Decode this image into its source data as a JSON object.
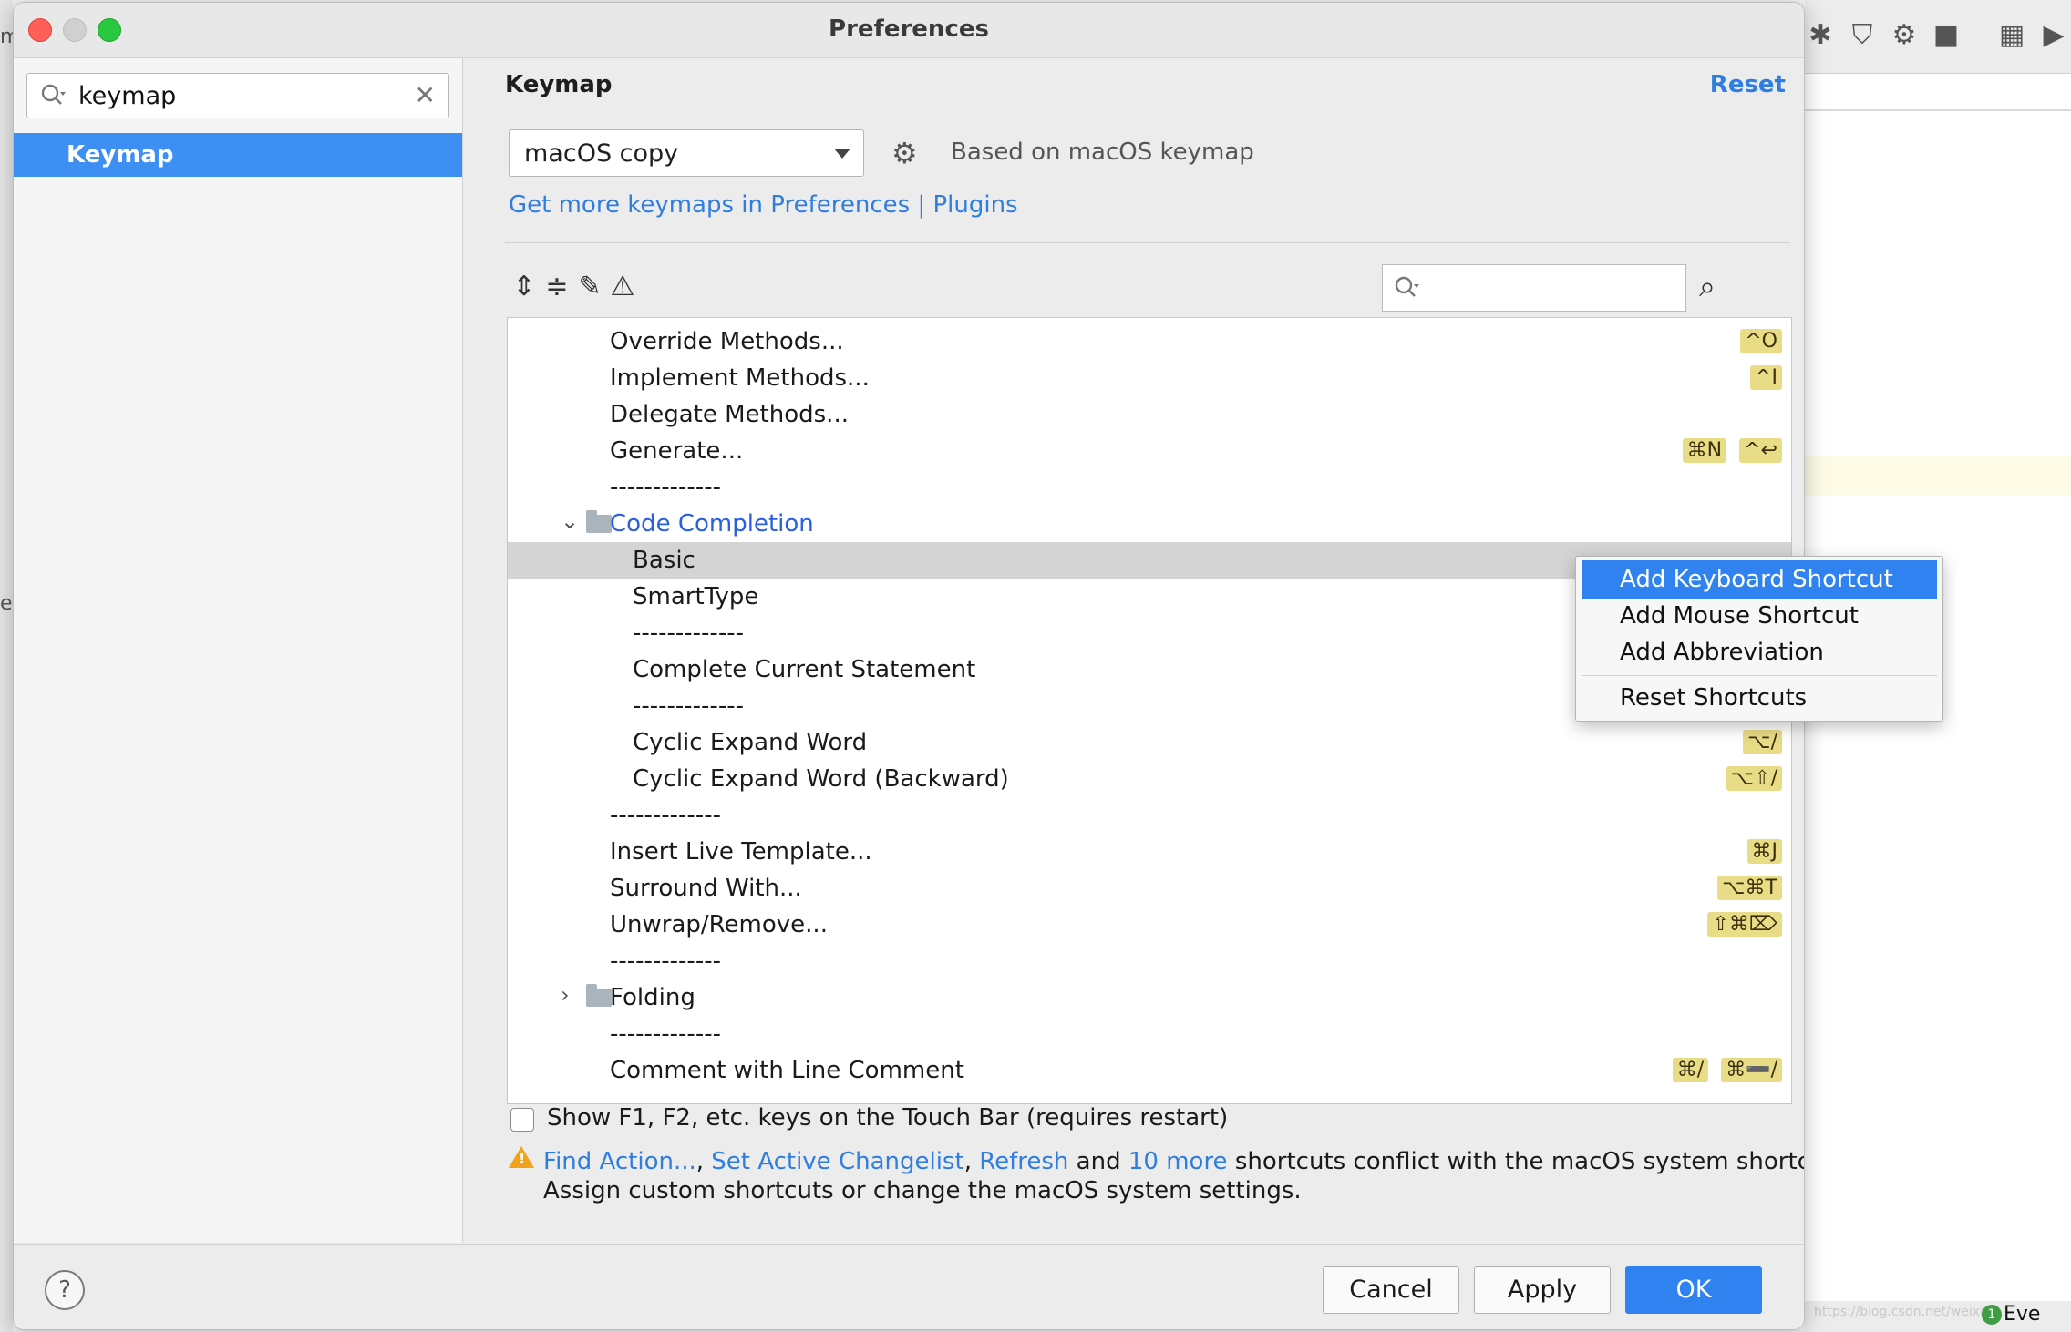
{
  "window": {
    "title": "Preferences"
  },
  "sidebar": {
    "search_value": "keymap",
    "items": [
      {
        "label": "Keymap"
      }
    ]
  },
  "main": {
    "section_title": "Keymap",
    "reset_label": "Reset",
    "keymap_select_value": "macOS copy",
    "based_on": "Based on macOS keymap",
    "plugins_link": "Get more keymaps in Preferences | Plugins",
    "filter_placeholder": ""
  },
  "tree": [
    {
      "label": "Override Methods...",
      "keys": [
        "^O"
      ]
    },
    {
      "label": "Implement Methods...",
      "keys": [
        "^I"
      ]
    },
    {
      "label": "Delegate Methods...",
      "keys": []
    },
    {
      "label": "Generate...",
      "keys": [
        "⌘N",
        "^↩"
      ]
    },
    {
      "label": "-------------",
      "keys": []
    },
    {
      "label": "Code Completion",
      "keys": []
    },
    {
      "label": "Basic",
      "keys": []
    },
    {
      "label": "SmartType",
      "keys": []
    },
    {
      "label": "-------------",
      "keys": []
    },
    {
      "label": "Complete Current Statement",
      "keys": []
    },
    {
      "label": "-------------",
      "keys": []
    },
    {
      "label": "Cyclic Expand Word",
      "keys": [
        "⌥/"
      ]
    },
    {
      "label": "Cyclic Expand Word (Backward)",
      "keys": [
        "⌥⇧/"
      ]
    },
    {
      "label": "-------------",
      "keys": []
    },
    {
      "label": "Insert Live Template...",
      "keys": [
        "⌘J"
      ]
    },
    {
      "label": "Surround With...",
      "keys": [
        "⌥⌘T"
      ]
    },
    {
      "label": "Unwrap/Remove...",
      "keys": [
        "⇧⌘⌦"
      ]
    },
    {
      "label": "-------------",
      "keys": []
    },
    {
      "label": "Folding",
      "keys": []
    },
    {
      "label": "-------------",
      "keys": []
    },
    {
      "label": "Comment with Line Comment",
      "keys": [
        "⌘/",
        "⌘➖/"
      ]
    }
  ],
  "context_menu": {
    "items": [
      {
        "label": "Add Keyboard Shortcut"
      },
      {
        "label": "Add Mouse Shortcut"
      },
      {
        "label": "Add Abbreviation"
      },
      {
        "label": "Reset Shortcuts"
      }
    ]
  },
  "touchbar_label": "Show F1, F2, etc. keys on the Touch Bar (requires restart)",
  "conflict": {
    "link1": "Find Action...",
    "sep1": ", ",
    "link2": "Set Active Changelist",
    "sep2": ", ",
    "link3": "Refresh",
    "and": " and ",
    "link4": "10 more",
    "rest": " shortcuts conflict with the macOS system shortcuts",
    "line2": "Assign custom shortcuts or change the macOS system settings."
  },
  "footer": {
    "help": "?",
    "cancel": "Cancel",
    "apply": "Apply",
    "ok": "OK"
  },
  "ide": {
    "status_text": "Eve",
    "badge": "1"
  }
}
